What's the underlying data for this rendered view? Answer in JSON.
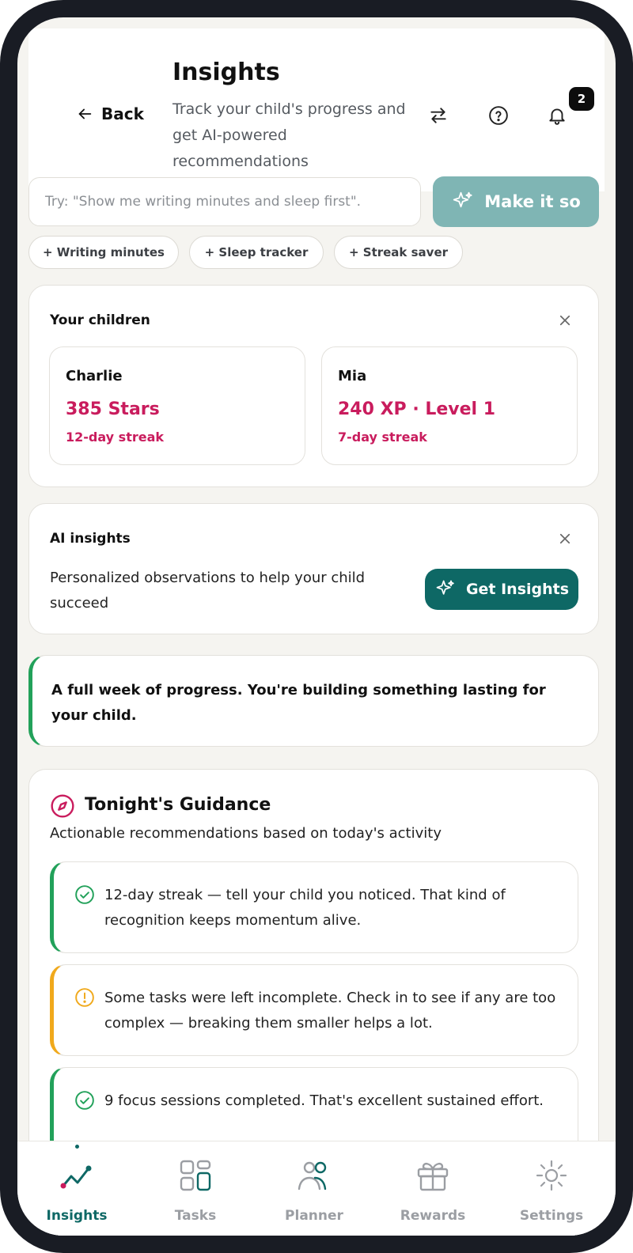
{
  "header": {
    "back_label": "Back",
    "title": "Insights",
    "subtitle": "Track your child's progress and get AI-powered recommendations",
    "notification_count": "2"
  },
  "prompt": {
    "placeholder": "Try: \"Show me writing minutes and sleep first\".",
    "button_label": "Make it so"
  },
  "chips": [
    "+ Writing minutes",
    "+ Sleep tracker",
    "+ Streak saver"
  ],
  "children_card": {
    "title": "Your children",
    "children": [
      {
        "name": "Charlie",
        "primary": "385 Stars",
        "streak": "12-day streak"
      },
      {
        "name": "Mia",
        "primary": "240 XP · Level 1",
        "streak": "7-day streak"
      }
    ]
  },
  "ai_insights": {
    "title": "AI insights",
    "description": "Personalized observations to help your child succeed",
    "button_label": "Get Insights"
  },
  "banner": {
    "text": "A full week of progress. You're building something lasting for your child."
  },
  "guidance": {
    "title": "Tonight's Guidance",
    "subtitle": "Actionable recommendations based on today's activity",
    "items": [
      {
        "type": "success",
        "icon": "check-circle-icon",
        "text": "12-day streak — tell your child you noticed. That kind of recognition keeps momentum alive."
      },
      {
        "type": "warning",
        "icon": "alert-circle-icon",
        "text": "Some tasks were left incomplete. Check in to see if any are too complex — breaking them smaller helps a lot."
      },
      {
        "type": "success",
        "icon": "check-circle-icon",
        "text": "9 focus sessions completed. That's excellent sustained effort."
      }
    ]
  },
  "tabbar": {
    "active": "Insights",
    "tabs": [
      {
        "label": "Insights",
        "icon": "trend-chart-icon"
      },
      {
        "label": "Tasks",
        "icon": "grid-icon"
      },
      {
        "label": "Planner",
        "icon": "people-icon"
      },
      {
        "label": "Rewards",
        "icon": "gift-icon"
      },
      {
        "label": "Settings",
        "icon": "sun-gear-icon"
      }
    ]
  },
  "colors": {
    "brand_teal": "#0e6865",
    "accent_light_teal": "#7fb5b4",
    "highlight_pink": "#c91c5d",
    "success_green": "#22a15a",
    "warning_amber": "#f0a91c"
  }
}
